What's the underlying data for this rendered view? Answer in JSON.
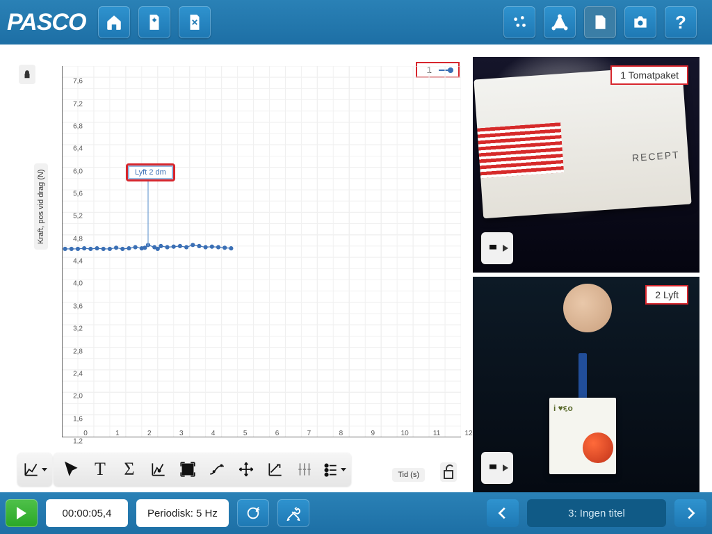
{
  "app": {
    "logo": "PASCO"
  },
  "toolbar_top": {
    "home": "home-icon",
    "new": "sparkle-doc-icon",
    "close": "close-doc-icon",
    "sensors": "dots-icon",
    "ruler": "compass-icon",
    "page": "page-icon",
    "camera": "camera-icon",
    "help": "?"
  },
  "chart": {
    "y_axis_label": "Kraft, pos vid drag (N)",
    "x_axis_label": "Tid (s)",
    "legend_label": "1",
    "annotation": "Lyft 2 dm",
    "lock_y": "locked",
    "lock_x": "unlocked"
  },
  "chart_data": {
    "type": "scatter",
    "title": "",
    "xlabel": "Tid (s)",
    "ylabel": "Kraft, pos vid drag (N)",
    "xlim": [
      0,
      12.5
    ],
    "ylim": [
      1.2,
      7.8
    ],
    "x_ticks": [
      0,
      1,
      2,
      3,
      4,
      5,
      6,
      7,
      8,
      9,
      10,
      11,
      12
    ],
    "y_ticks": [
      1.2,
      1.6,
      2.0,
      2.4,
      2.8,
      3.2,
      3.6,
      4.0,
      4.4,
      4.8,
      5.2,
      5.6,
      6.0,
      6.4,
      6.8,
      7.2,
      7.6
    ],
    "series": [
      {
        "name": "1",
        "x": [
          0.1,
          0.3,
          0.5,
          0.7,
          0.9,
          1.1,
          1.3,
          1.5,
          1.7,
          1.9,
          2.1,
          2.3,
          2.5,
          2.6,
          2.7,
          2.9,
          3.0,
          3.1,
          3.3,
          3.5,
          3.7,
          3.9,
          4.1,
          4.3,
          4.5,
          4.7,
          4.9,
          5.1,
          5.3
        ],
        "y": [
          4.55,
          4.55,
          4.55,
          4.56,
          4.55,
          4.56,
          4.55,
          4.55,
          4.57,
          4.55,
          4.56,
          4.58,
          4.56,
          4.57,
          4.62,
          4.58,
          4.55,
          4.6,
          4.58,
          4.59,
          4.6,
          4.58,
          4.62,
          4.6,
          4.58,
          4.59,
          4.58,
          4.57,
          4.56
        ]
      }
    ],
    "annotations": [
      {
        "text": "Lyft 2 dm",
        "x": 2.7,
        "y": 5.8,
        "points_to": {
          "x": 2.7,
          "y": 4.6
        }
      }
    ]
  },
  "images": {
    "card1_label": "1 Tomatpaket",
    "card2_label": "2 Lyft"
  },
  "bottom": {
    "time": "00:00:05,4",
    "rate": "Periodisk: 5 Hz",
    "page_title": "3: Ingen titel"
  }
}
